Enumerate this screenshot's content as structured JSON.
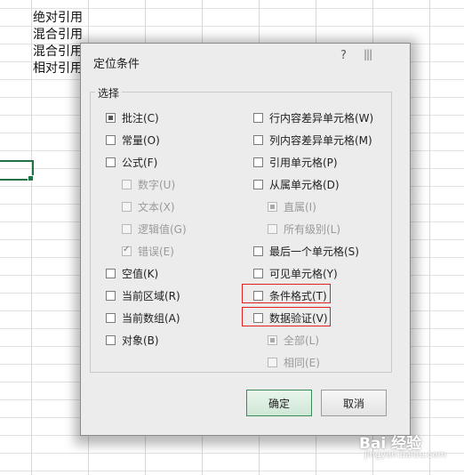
{
  "sheet": {
    "cells": [
      "绝对引用",
      "混合引用",
      "混合引用",
      "相对引用"
    ]
  },
  "dialog": {
    "title": "定位条件",
    "help_label": "?",
    "close_label": "|||",
    "group_label": "选择",
    "left_options": [
      {
        "label": "批注(C)",
        "checked": true,
        "enabled": true
      },
      {
        "label": "常量(O)",
        "checked": false,
        "enabled": true
      },
      {
        "label": "公式(F)",
        "checked": false,
        "enabled": true
      },
      {
        "label": "数字(U)",
        "checked": false,
        "enabled": false
      },
      {
        "label": "文本(X)",
        "checked": false,
        "enabled": false
      },
      {
        "label": "逻辑值(G)",
        "checked": false,
        "enabled": false
      },
      {
        "label": "错误(E)",
        "checked": true,
        "enabled": false
      },
      {
        "label": "空值(K)",
        "checked": false,
        "enabled": true
      },
      {
        "label": "当前区域(R)",
        "checked": false,
        "enabled": true
      },
      {
        "label": "当前数组(A)",
        "checked": false,
        "enabled": true
      },
      {
        "label": "对象(B)",
        "checked": false,
        "enabled": true
      }
    ],
    "right_options": [
      {
        "label": "行内容差异单元格(W)",
        "checked": false,
        "enabled": true
      },
      {
        "label": "列内容差异单元格(M)",
        "checked": false,
        "enabled": true
      },
      {
        "label": "引用单元格(P)",
        "checked": false,
        "enabled": true
      },
      {
        "label": "从属单元格(D)",
        "checked": false,
        "enabled": true
      },
      {
        "label": "直属(I)",
        "checked": true,
        "enabled": false
      },
      {
        "label": "所有级别(L)",
        "checked": false,
        "enabled": false
      },
      {
        "label": "最后一个单元格(S)",
        "checked": false,
        "enabled": true
      },
      {
        "label": "可见单元格(Y)",
        "checked": false,
        "enabled": true
      },
      {
        "label": "条件格式(T)",
        "checked": false,
        "enabled": true,
        "highlighted": true
      },
      {
        "label": "数据验证(V)",
        "checked": false,
        "enabled": true,
        "highlighted": true
      },
      {
        "label": "全部(L)",
        "checked": true,
        "enabled": false
      },
      {
        "label": "相同(E)",
        "checked": false,
        "enabled": false
      }
    ],
    "ok_label": "确定",
    "cancel_label": "取消"
  },
  "watermark": {
    "main": "Bai 经验",
    "sub": "jingyan.baidu.com"
  },
  "colors": {
    "highlight_border": "#e02020",
    "selection_green": "#217346",
    "ok_button_border": "#3a8a5a"
  }
}
